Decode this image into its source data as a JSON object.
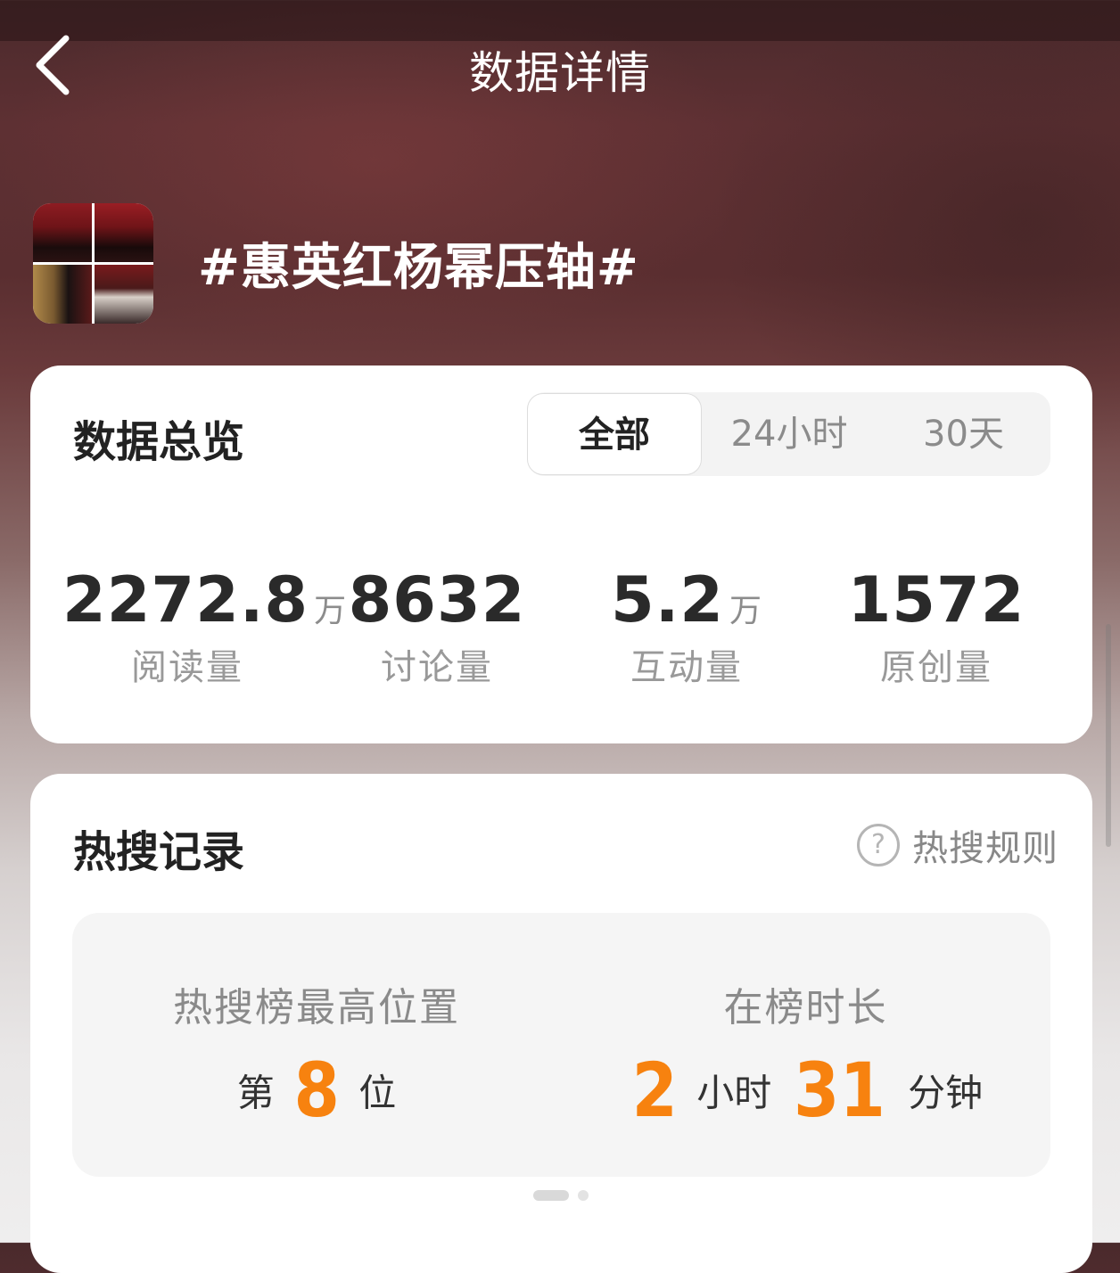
{
  "header": {
    "title": "数据详情",
    "back_icon": "chevron-left-icon"
  },
  "topic": {
    "title": "#惠英红杨幂压轴#"
  },
  "overview": {
    "heading": "数据总览",
    "tabs": [
      {
        "label": "全部",
        "active": true
      },
      {
        "label": "24小时",
        "active": false
      },
      {
        "label": "30天",
        "active": false
      }
    ],
    "stats": [
      {
        "value": "2272.8",
        "unit": "万",
        "label": "阅读量"
      },
      {
        "value": "8632",
        "unit": "",
        "label": "讨论量"
      },
      {
        "value": "5.2",
        "unit": "万",
        "label": "互动量"
      },
      {
        "value": "1572",
        "unit": "",
        "label": "原创量"
      }
    ]
  },
  "hot_search": {
    "heading": "热搜记录",
    "rules_label": "热搜规则",
    "rules_icon": "question-circle-icon",
    "highest_position": {
      "label": "热搜榜最高位置",
      "prefix": "第",
      "value": "8",
      "suffix": "位"
    },
    "duration": {
      "label": "在榜时长",
      "hours": "2",
      "hours_unit": "小时",
      "minutes": "31",
      "minutes_unit": "分钟"
    }
  },
  "colors": {
    "accent": "#f7820f",
    "card_bg": "#ffffff",
    "muted_text": "#999999",
    "dark_text": "#222222"
  }
}
